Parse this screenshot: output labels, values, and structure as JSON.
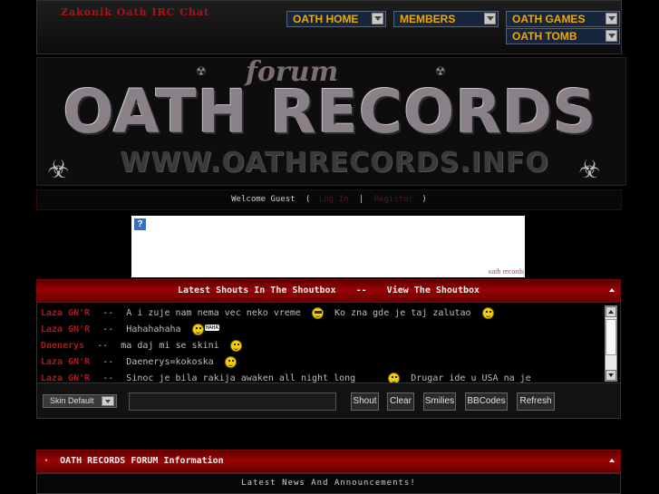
{
  "topbar": {
    "irc_link": "Zakonik Oath IRC Chat",
    "nav": [
      {
        "label": "OATH HOME"
      },
      {
        "label": "MEMBERS"
      },
      {
        "label": "OATH GAMES"
      },
      {
        "label": "OATH TOMB"
      }
    ]
  },
  "banner": {
    "forum_text": "forum",
    "title": "OATH RECORDS",
    "url": "WWW.OATHRECORDS.INFO"
  },
  "welcome": {
    "text": "Welcome Guest",
    "open_paren": "(",
    "login": "Log In",
    "separator": "|",
    "register": "Register",
    "close_paren": ")"
  },
  "ad": {
    "text": "oath records"
  },
  "shoutbox": {
    "header_latest": "Latest Shouts In The Shoutbox",
    "header_sep": "--",
    "header_view": "View The Shoutbox",
    "rows": [
      {
        "name": "Laza GN'R",
        "dash": "--",
        "message": "A i zuje nam nema vec neko vreme",
        "message2": "Ko zna gde je taj zalutao"
      },
      {
        "name": "Laza GN'R",
        "dash": "--",
        "message": "Hahahahaha",
        "badge": "HAHA"
      },
      {
        "name": "Daenerys",
        "dash": "--",
        "message": "ma daj mi se skini"
      },
      {
        "name": "Laza GN'R",
        "dash": "--",
        "message": "Daenerys=kokoska"
      },
      {
        "name": "Laza GN'R",
        "dash": "--",
        "message": "Sinoc je bila rakija awaken all night long",
        "message2": "Drugar ide u USA na je"
      }
    ],
    "controls": {
      "skin_label": "Skin Default",
      "input_value": "",
      "shout": "Shout",
      "clear": "Clear",
      "smilies": "Smilies",
      "bbcodes": "BBCodes",
      "refresh": "Refresh"
    }
  },
  "info": {
    "header_bullet": "·",
    "header": "OATH RECORDS FORUM Information",
    "news": "Latest News And Announcements!"
  },
  "colors": {
    "accent_red": "#9a0404",
    "name_red": "#b01818",
    "nav_text": "#f0a800",
    "nav_bg": "#17263c"
  }
}
